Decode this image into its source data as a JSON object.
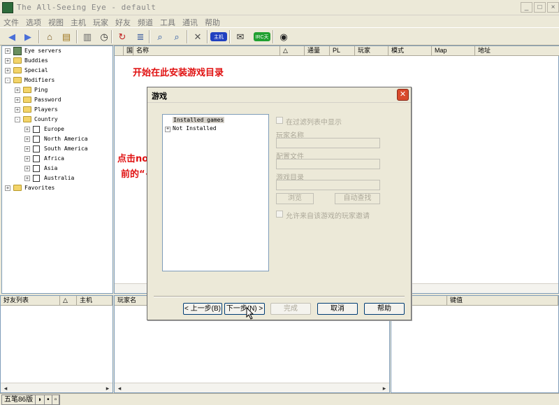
{
  "window": {
    "title": "The All-Seeing Eye - default",
    "controls": [
      "_",
      "□",
      "×"
    ]
  },
  "menu": [
    "文件",
    "选项",
    "视图",
    "主机",
    "玩家",
    "好友",
    "频道",
    "工具",
    "通讯",
    "帮助"
  ],
  "toolbar_icons": [
    "back-icon",
    "forward-icon",
    "home-icon",
    "folder-open-icon",
    "book-icon",
    "stopwatch-icon",
    "refresh-icon",
    "server-list-icon",
    "find-server-icon",
    "find-player-icon",
    "tools-icon",
    "host-icon",
    "mail-icon",
    "irc-icon",
    "eye-icon"
  ],
  "toolbar_badges": {
    "host": "主机",
    "irc": "IRC天"
  },
  "tree": [
    {
      "label": "Eye servers",
      "indent": 0,
      "kind": "globe",
      "exp": "+"
    },
    {
      "label": "Buddies",
      "indent": 0,
      "kind": "folder",
      "exp": "+"
    },
    {
      "label": "Special",
      "indent": 0,
      "kind": "folder",
      "exp": "+"
    },
    {
      "label": "Modifiers",
      "indent": 0,
      "kind": "folder",
      "exp": "-"
    },
    {
      "label": "Ping",
      "indent": 1,
      "kind": "folder",
      "exp": "+"
    },
    {
      "label": "Password",
      "indent": 1,
      "kind": "folder",
      "exp": "+"
    },
    {
      "label": "Players",
      "indent": 1,
      "kind": "folder",
      "exp": "+"
    },
    {
      "label": "Country",
      "indent": 1,
      "kind": "folder",
      "exp": "-"
    },
    {
      "label": "Europe",
      "indent": 2,
      "kind": "check",
      "exp": "+"
    },
    {
      "label": "North America",
      "indent": 2,
      "kind": "check",
      "exp": "+"
    },
    {
      "label": "South America",
      "indent": 2,
      "kind": "check",
      "exp": "+"
    },
    {
      "label": "Africa",
      "indent": 2,
      "kind": "check",
      "exp": "+"
    },
    {
      "label": "Asia",
      "indent": 2,
      "kind": "check",
      "exp": "+"
    },
    {
      "label": "Australia",
      "indent": 2,
      "kind": "check",
      "exp": "+"
    },
    {
      "label": "Favorites",
      "indent": 0,
      "kind": "folder",
      "exp": "+"
    }
  ],
  "server_columns": [
    {
      "label": "",
      "w": 13
    },
    {
      "label": "国",
      "w": 14
    },
    {
      "label": "名称",
      "w": 210
    },
    {
      "label": "△",
      "w": 35
    },
    {
      "label": "通量",
      "w": 36
    },
    {
      "label": "PL",
      "w": 36
    },
    {
      "label": "玩家",
      "w": 48
    },
    {
      "label": "模式",
      "w": 62
    },
    {
      "label": "Map",
      "w": 62
    },
    {
      "label": "地址",
      "w": 121
    }
  ],
  "buddy_columns": [
    {
      "label": "好友列表",
      "w": 85
    },
    {
      "label": "△",
      "w": 24
    },
    {
      "label": "主机",
      "w": 51
    }
  ],
  "player_columns": [
    {
      "label": "玩家名",
      "w": 60
    }
  ],
  "rules_columns": [
    {
      "label": "",
      "w": 80
    },
    {
      "label": "键值",
      "w": 159
    }
  ],
  "annotations": {
    "top": "开始在此安装游戏目录",
    "line1": "点击not installed",
    "line2": "前的“+”号以展开菜单"
  },
  "dialog": {
    "title": "游戏",
    "tree_items": [
      "Installed games",
      "Not Installed"
    ],
    "show_in_filter": "在过滤列表中显示",
    "game_name_label": "玩家名称",
    "config_file_label": "配置文件",
    "game_dir_label": "游戏目录",
    "browse": "浏览",
    "auto_find": "自动查找",
    "allow_invite": "允许来自该游戏的玩家邀请",
    "back": "< 上一步(B)",
    "next": "下一步(N) >",
    "finish": "完成",
    "cancel": "取消",
    "help": "帮助"
  },
  "statusbar": {
    "ime": [
      "五笔86版",
      "◗",
      "•",
      "▫"
    ]
  },
  "colors": {
    "annotation": "#e01010",
    "window_bg": "#ece9d8",
    "close_button": "#d84a2c"
  }
}
